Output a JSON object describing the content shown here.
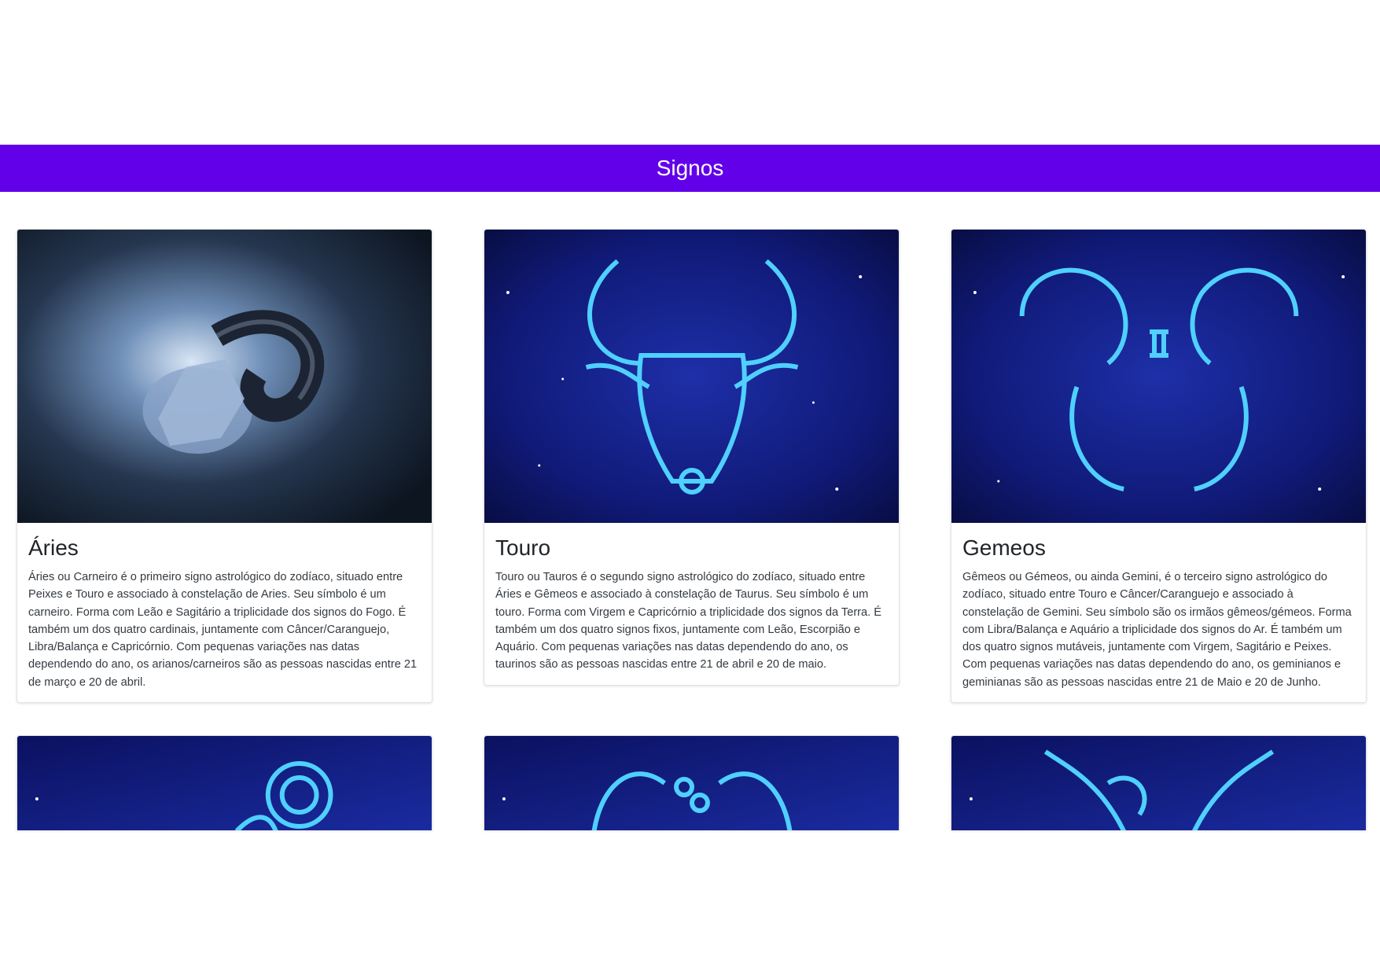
{
  "header": {
    "title": "Signos",
    "bg_color": "#6200ea"
  },
  "cards": [
    {
      "title": "Áries",
      "image_icon": "ram-icon",
      "text": "Áries ou Carneiro é o primeiro signo astrológico do zodíaco, situado entre Peixes e Touro e associado à constelação de Aries. Seu símbolo é um carneiro. Forma com Leão e Sagitário a triplicidade dos signos do Fogo. É também um dos quatro cardinais, juntamente com Câncer/Caranguejo, Libra/Balança e Capricórnio. Com pequenas variações nas datas dependendo do ano, os arianos/carneiros são as pessoas nascidas entre 21 de março e 20 de abril."
    },
    {
      "title": "Touro",
      "image_icon": "bull-icon",
      "text": "Touro ou Tauros é o segundo signo astrológico do zodíaco, situado entre Áries e Gêmeos e associado à constelação de Taurus. Seu símbolo é um touro. Forma com Virgem e Capricórnio a triplicidade dos signos da Terra. É também um dos quatro signos fixos, juntamente com Leão, Escorpião e Aquário. Com pequenas variações nas datas dependendo do ano, os taurinos são as pessoas nascidas entre 21 de abril e 20 de maio."
    },
    {
      "title": "Gemeos",
      "image_icon": "twins-icon",
      "text": "Gêmeos ou Gémeos, ou ainda Gemini, é o terceiro signo astrológico do zodíaco, situado entre Touro e Câncer/Caranguejo e associado à constelação de Gemini. Seu símbolo são os irmãos gêmeos/gémeos. Forma com Libra/Balança e Aquário a triplicidade dos signos do Ar. É também um dos quatro signos mutáveis, juntamente com Virgem, Sagitário e Peixes. Com pequenas variações nas datas dependendo do ano, os geminianos e geminianas são as pessoas nascidas entre 21 de Maio e 20 de Junho."
    },
    {
      "image_icon": "cancer-crab-icon"
    },
    {
      "image_icon": "leo-lion-icon"
    },
    {
      "image_icon": "capricorn-icon"
    }
  ]
}
